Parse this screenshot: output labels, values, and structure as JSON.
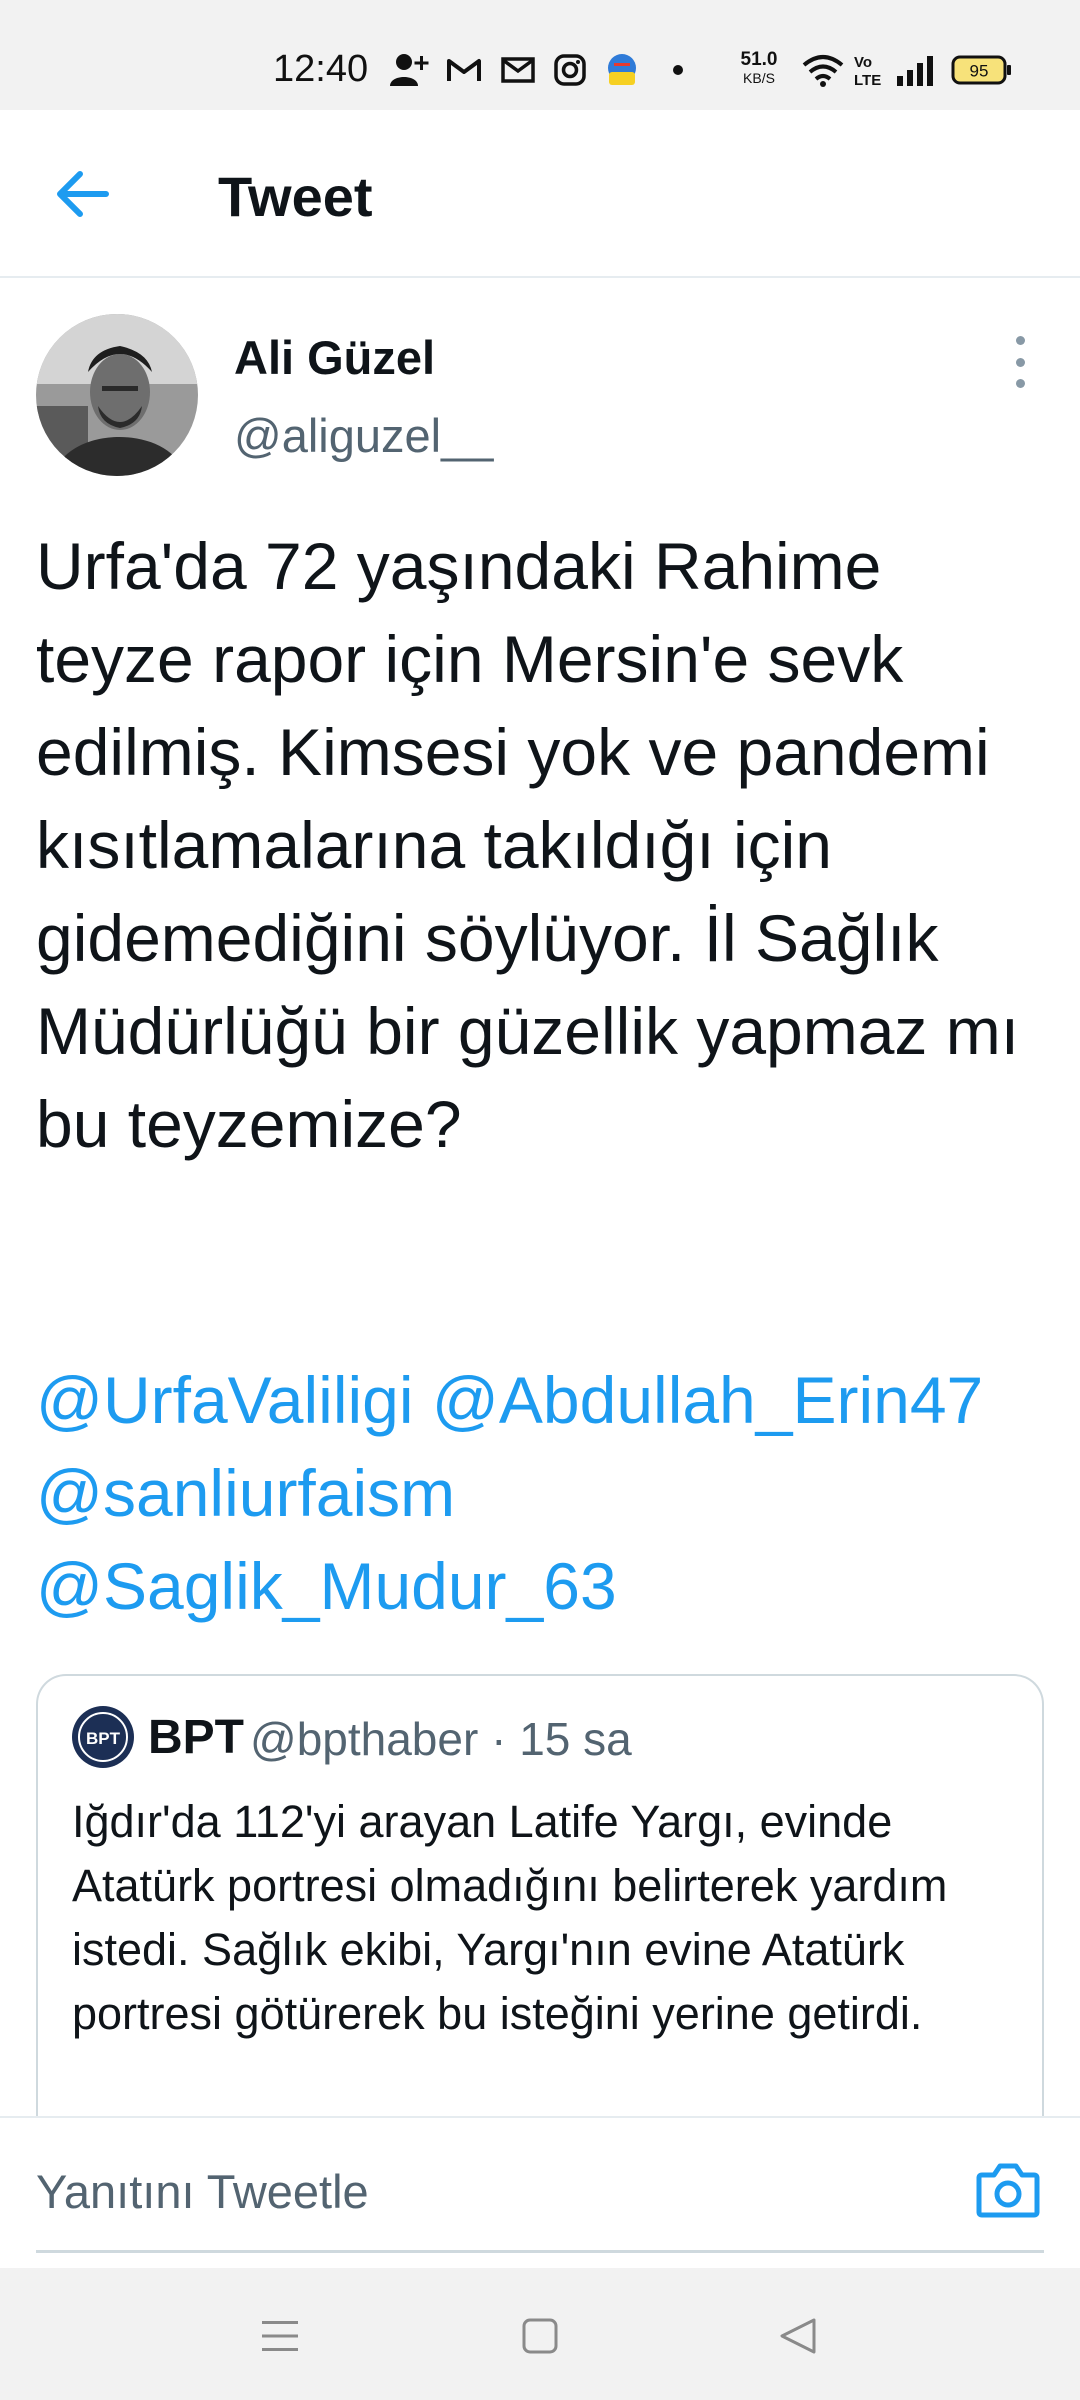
{
  "status_bar": {
    "time": "12:40",
    "net_speed_value": "51.0",
    "net_speed_unit": "KB/S",
    "volte_label": "Vo LTE",
    "battery": "95",
    "icons": [
      "person-add-icon",
      "gmail-icon",
      "mail-icon",
      "instagram-icon",
      "app-badge-icon",
      "dot-icon",
      "wifi-icon",
      "volte-icon",
      "signal-icon",
      "battery-icon"
    ]
  },
  "header": {
    "title": "Tweet",
    "back_icon": "arrow-left-icon"
  },
  "tweet": {
    "author_name": "Ali Güzel",
    "author_handle": "@aliguzel__",
    "body": "Urfa'da 72 yaşındaki Rahime teyze rapor için Mersin'e sevk edilmiş. Kimsesi yok ve pandemi kısıtlamalarına takıldığı için gidemediğini söylüyor. İl Sağlık Müdürlüğü bir güzellik yapmaz mı bu teyzemize?",
    "mentions": [
      "@UrfaValiligi",
      "@Abdullah_Erin47",
      "@sanliurfaism",
      "@Saglik_Mudur_63"
    ]
  },
  "quoted_tweet": {
    "name": "BPT",
    "handle": "@bpthaber",
    "separator": "·",
    "time": "15 sa",
    "avatar_text": "BPT",
    "text": "Iğdır'da 112'yi arayan Latife Yargı, evinde Atatürk portresi olmadığını belirterek yardım istedi. Sağlık ekibi, Yargı'nın evine Atatürk portresi götürerek bu isteğini yerine getirdi."
  },
  "reply": {
    "placeholder": "Yanıtını Tweetle",
    "camera_icon": "camera-icon"
  },
  "nav_bar": {
    "icons": [
      "menu-icon",
      "home-square-icon",
      "back-triangle-icon"
    ]
  },
  "colors": {
    "accent": "#1d9bf0",
    "text": "#0f1419",
    "secondary": "#536471",
    "border": "#cfd9de"
  }
}
